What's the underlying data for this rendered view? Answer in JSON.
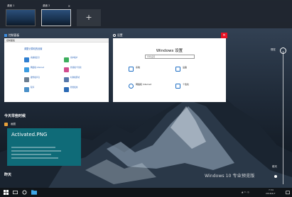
{
  "desktops": {
    "items": [
      {
        "label": "桌面 1"
      },
      {
        "label": "桌面 2"
      }
    ],
    "new_label": "+"
  },
  "windows": {
    "control_panel": {
      "title": "控制面板",
      "breadcrumb": "控制面板",
      "heading": "调整计算机的设置",
      "items": [
        {
          "label": "系统和安全"
        },
        {
          "label": "网络和 Internet"
        },
        {
          "label": "硬件和声音"
        },
        {
          "label": "程序"
        },
        {
          "label": "用户帐户"
        },
        {
          "label": "外观和个性化"
        },
        {
          "label": "时钟和区域"
        },
        {
          "label": "轻松使用"
        }
      ]
    },
    "settings": {
      "title": "设置",
      "heading": "Windows 设置",
      "search_placeholder": "查找设置",
      "items": [
        {
          "label": "系统"
        },
        {
          "label": "设备"
        },
        {
          "label": "网络和 Internet"
        },
        {
          "label": "个性化"
        }
      ],
      "close_glyph": "✕"
    }
  },
  "timeline": {
    "now_label": "现在",
    "earlier_label": "前天",
    "section_today": "今天早些时候",
    "activity_app": "画图",
    "activity_title": "Activated.PNG",
    "activity_subtitle": "",
    "section_earlier": "昨天"
  },
  "watermark": "Windows 10 专业预览版",
  "taskbar": {
    "time": "7:34",
    "date": "2018/4/7"
  },
  "colors": {
    "accent": "#0f6b78",
    "close_red": "#e81123",
    "taskbar": "#101418"
  }
}
